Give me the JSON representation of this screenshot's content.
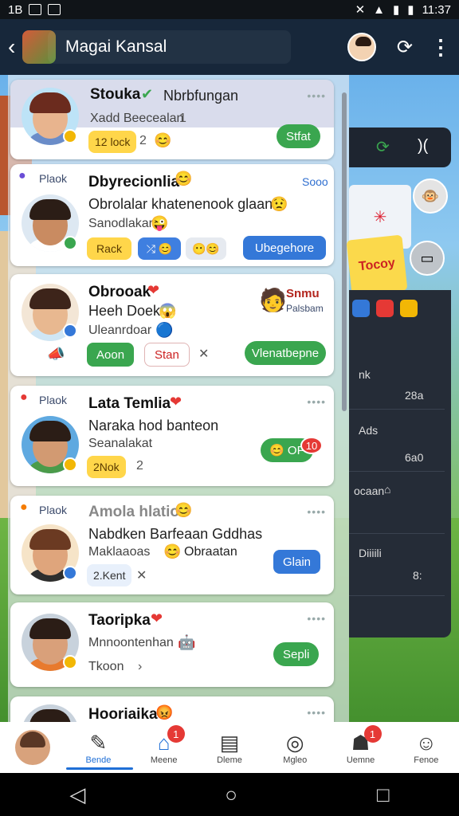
{
  "status_bar": {
    "left_label": "1B",
    "time": "11:37"
  },
  "app_bar": {
    "title": "Magai Kansal"
  },
  "cards": [
    {
      "name": "Stouka",
      "name_extra": "Nbrbfungan",
      "line": "Xadd Beecealan",
      "line_num": "1",
      "chip": "12 lock",
      "count": "2",
      "action": "Stfat"
    },
    {
      "tag": "Plaok",
      "name": "Dbyrecionlia",
      "name_extra": "Sooo",
      "line": "Obrolalar khatenenook glaant",
      "sub": "Sanodlakar",
      "chip1": "Rack",
      "action": "Ubegehore"
    },
    {
      "name": "Obrooak",
      "line": "Heeh Doek",
      "sub": "Uleanrdoar",
      "right_name": "Snmu",
      "right_sub": "Palsbam",
      "btn1": "Aoon",
      "btn2": "Stan",
      "action": "Vlenatbepne"
    },
    {
      "tag": "Plaok",
      "name": "Lata Temlia",
      "line": "Naraka hod banteon",
      "sub": "Seanalakat",
      "chip": "2Nok",
      "count": "2",
      "of_text": "OF",
      "of_count": "10"
    },
    {
      "tag": "Plaok",
      "name": "Amola hlatio",
      "line": "Nabdken Barfeaan Gddhas",
      "sub": "Maklaaoas",
      "sub_extra": "Obraatan",
      "chip": "2.Kent",
      "action": "Glain"
    },
    {
      "name": "Taoripka",
      "sub": "Mnnoontenhan",
      "chip": "Tkoon",
      "action": "Sepli"
    },
    {
      "name": "Hooriaika"
    }
  ],
  "right_panel": {
    "banner": "Tocoy",
    "rows": [
      {
        "text": "nk",
        "num": "28a"
      },
      {
        "text": "Ads",
        "num": "6a0"
      },
      {
        "text": "ocaan",
        "num": ""
      },
      {
        "text": "Diiiili",
        "num": "8:"
      }
    ]
  },
  "bottom_nav": [
    {
      "label": "Bende",
      "badge": ""
    },
    {
      "label": "Meene",
      "badge": "1"
    },
    {
      "label": "Dleme",
      "badge": ""
    },
    {
      "label": "Mgleo",
      "badge": ""
    },
    {
      "label": "Uemne",
      "badge": "1"
    },
    {
      "label": "Fenoe",
      "badge": ""
    }
  ],
  "colors": {
    "accent": "#3aa64f",
    "primary": "#3478d8",
    "app_bar": "#17273a"
  }
}
